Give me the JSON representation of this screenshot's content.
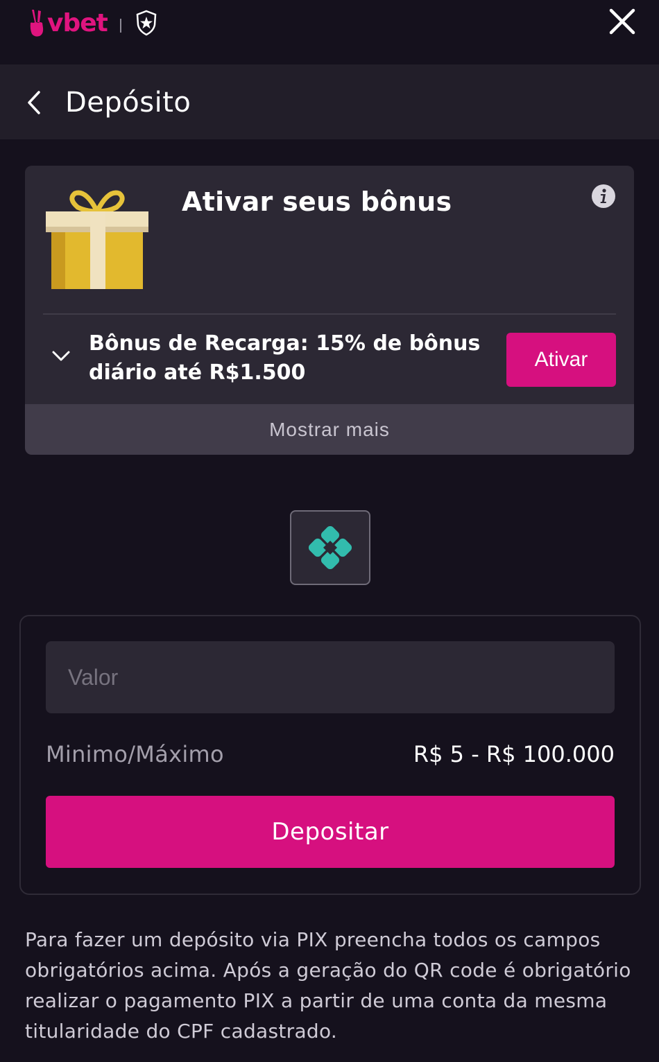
{
  "brand": {
    "logo_text": "vbet",
    "accent_color": "#d6107f",
    "partner_icon": "shield-star-icon"
  },
  "topbar": {
    "close_icon": "close-icon"
  },
  "header": {
    "back_icon": "chevron-left-icon",
    "title": "Depósito"
  },
  "bonus": {
    "icon": "gift-icon",
    "title": "Ativar seus bônus",
    "info_icon": "info-icon",
    "expand_icon": "chevron-down-icon",
    "description": "Bônus de Recarga: 15% de bônus diário até R$1.500",
    "activate_label": "Ativar",
    "show_more_label": "Mostrar mais"
  },
  "payment_method": {
    "icon": "pix-icon",
    "icon_color": "#32bcad"
  },
  "form": {
    "amount_placeholder": "Valor",
    "amount_value": "",
    "limits_label": "Minimo/Máximo",
    "limits_value": "R$ 5 - R$ 100.000",
    "submit_label": "Depositar"
  },
  "footnote": "Para fazer um depósito via PIX preencha todos os campos obrigatórios acima. Após a geração do QR code é obrigatório realizar o pagamento PIX a partir de uma conta da mesma titularidade do CPF cadastrado."
}
